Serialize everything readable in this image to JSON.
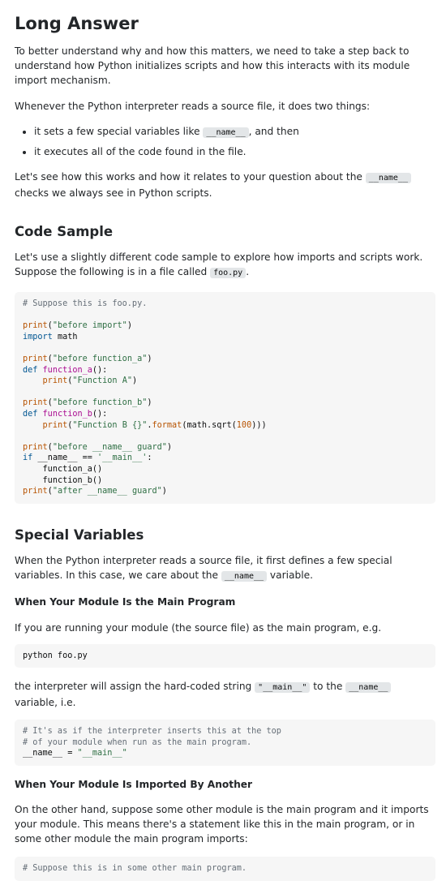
{
  "title": "Long Answer",
  "intro_p1": "To better understand why and how this matters, we need to take a step back to understand how Python initializes scripts and how this interacts with its module import mechanism.",
  "intro_p2": "Whenever the Python interpreter reads a source file, it does two things:",
  "bullets": {
    "b1_pre": "it sets a few special variables like ",
    "b1_code": "__name__",
    "b1_post": ", and then",
    "b2": "it executes all of the code found in the file."
  },
  "intro_p3": {
    "pre": "Let's see how this works and how it relates to your question about the ",
    "code": "__name__",
    "post": " checks we always see in Python scripts."
  },
  "section_code_sample": {
    "heading": "Code Sample",
    "p_pre": "Let's use a slightly different code sample to explore how imports and scripts work. Suppose the following is in a file called ",
    "p_code": "foo.py",
    "p_post": ".",
    "code_block": {
      "l1": "# Suppose this is foo.py.",
      "print": "print",
      "import_kw": "import",
      "math": "math",
      "def_kw": "def",
      "if_kw": "if",
      "s_before_import": "\"before import\"",
      "s_before_fa": "\"before function_a\"",
      "fn_a": "function_a",
      "s_function_a": "\"Function A\"",
      "s_before_fb": "\"before function_b\"",
      "fn_b": "function_b",
      "s_function_b": "\"Function B {}\"",
      "format": "format",
      "sqrt_expr": "(math.sqrt(",
      "num": "100",
      "s_before_guard": "\"before __name__ guard\"",
      "name_var": "__name__",
      "s_main_single": "'__main__'",
      "call_a": "function_a()",
      "call_b": "function_b()",
      "s_after_guard": "\"after __name__ guard\""
    }
  },
  "section_special": {
    "heading": "Special Variables",
    "p_pre": "When the Python interpreter reads a source file, it first defines a few special variables. In this case, we care about the ",
    "p_code": "__name__",
    "p_post": " variable.",
    "sub1": "When Your Module Is the Main Program",
    "p2": "If you are running your module (the source file) as the main program, e.g.",
    "cmd": "python foo.py",
    "p3_pre": "the interpreter will assign the hard-coded string ",
    "p3_code1": "\"__main__\"",
    "p3_mid": " to the ",
    "p3_code2": "__name__",
    "p3_post": " variable, i.e.",
    "code2_l1": "# It's as if the interpreter inserts this at the top",
    "code2_l2": "# of your module when run as the main program.",
    "code2_l3_var": "__name__",
    "code2_l3_eq": " = ",
    "code2_l3_str": "\"__main__\"",
    "sub2": "When Your Module Is Imported By Another",
    "p4": "On the other hand, suppose some other module is the main program and it imports your module. This means there's a statement like this in the main program, or in some other module the main program imports:",
    "code3_l1": "# Suppose this is in some other main program."
  }
}
